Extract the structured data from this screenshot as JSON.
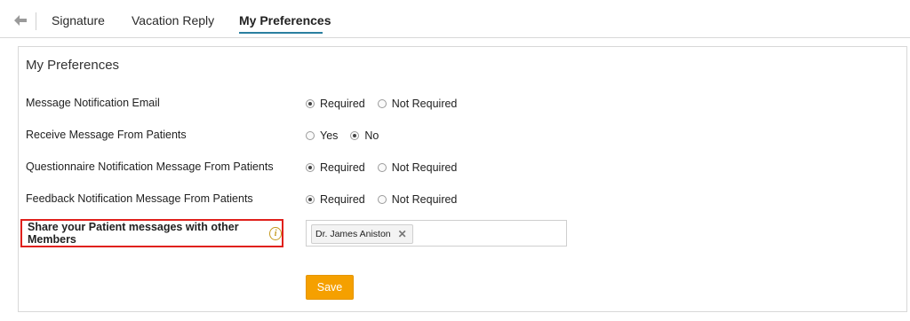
{
  "tabs": [
    {
      "label": "Signature"
    },
    {
      "label": "Vacation Reply"
    },
    {
      "label": "My Preferences"
    }
  ],
  "panel": {
    "title": "My Preferences"
  },
  "rows": [
    {
      "label": "Message Notification Email",
      "options": [
        "Required",
        "Not Required"
      ],
      "selected": "Required"
    },
    {
      "label": "Receive Message From Patients",
      "options": [
        "Yes",
        "No"
      ],
      "selected": "No"
    },
    {
      "label": "Questionnaire Notification Message From Patients",
      "options": [
        "Required",
        "Not Required"
      ],
      "selected": "Required"
    },
    {
      "label": "Feedback Notification Message From Patients",
      "options": [
        "Required",
        "Not Required"
      ],
      "selected": "Required"
    }
  ],
  "share": {
    "label": "Share your Patient messages with other Members",
    "info_icon": "info-icon",
    "members": [
      "Dr. James Aniston"
    ]
  },
  "save_label": "Save",
  "colors": {
    "accent_underline": "#2a7fa0",
    "save_button": "#f5a000",
    "highlight_border": "#e0201c",
    "info_icon": "#c59a20"
  }
}
